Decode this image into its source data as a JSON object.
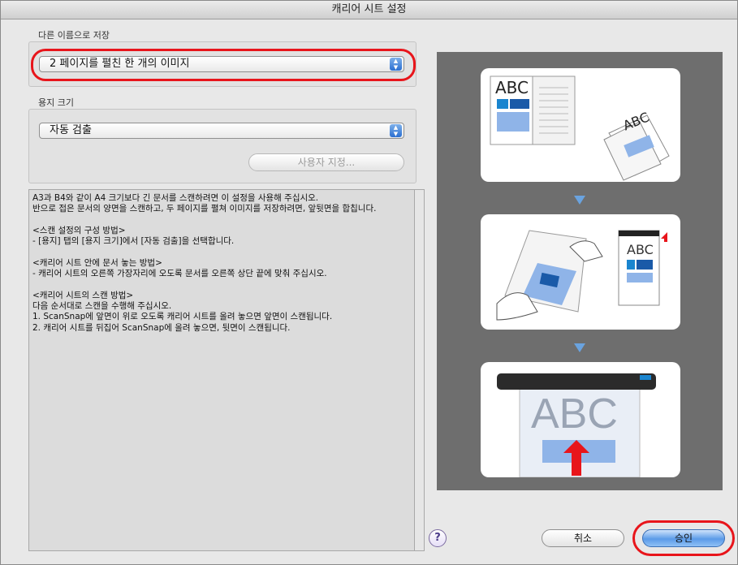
{
  "window": {
    "title": "캐리어 시트 설정"
  },
  "save_as": {
    "label": "다른 이름으로 저장",
    "selected": "2 페이지를 펼친 한 개의 이미지"
  },
  "paper_size": {
    "label": "용지 크기",
    "selected": "자동 검출",
    "custom_button": "사용자 지정..."
  },
  "description": "A3과 B4와 같이 A4 크기보다 긴 문서를 스캔하려면 이 설정을 사용해 주십시오.\n반으로 접은 문서의 양면을 스캔하고, 두 페이지를 펼쳐 이미지를 저장하려면, 앞뒷면을 합칩니다.\n\n<스캔 설정의 구성 방법>\n- [용지] 탭의 [용지 크기]에서 [자동 검출]을 선택합니다.\n\n<캐리어 시트 안에 문서 놓는 방법>\n- 캐리어 시트의 오른쪽 가장자리에 오도록 문서를 오른쪽 상단 끝에 맞춰 주십시오.\n\n<캐리어 시트의 스캔 방법>\n다음 순서대로 스캔을 수행해 주십시오.\n1. ScanSnap에 앞면이 위로 오도록 캐리어 시트를 올려 놓으면 앞면이 스캔됩니다.\n2. 캐리어 시트를 뒤집어 ScanSnap에 올려 놓으면, 뒷면이 스캔됩니다.",
  "illustration": {
    "step1_text_a": "ABC",
    "step1_text_b": "ABC",
    "step2_text": "ABC",
    "step3_text": "ABC"
  },
  "footer": {
    "help_icon": "?",
    "cancel": "취소",
    "ok": "승인"
  },
  "colors": {
    "highlight": "#e8151b",
    "accent": "#2a6fd1"
  }
}
